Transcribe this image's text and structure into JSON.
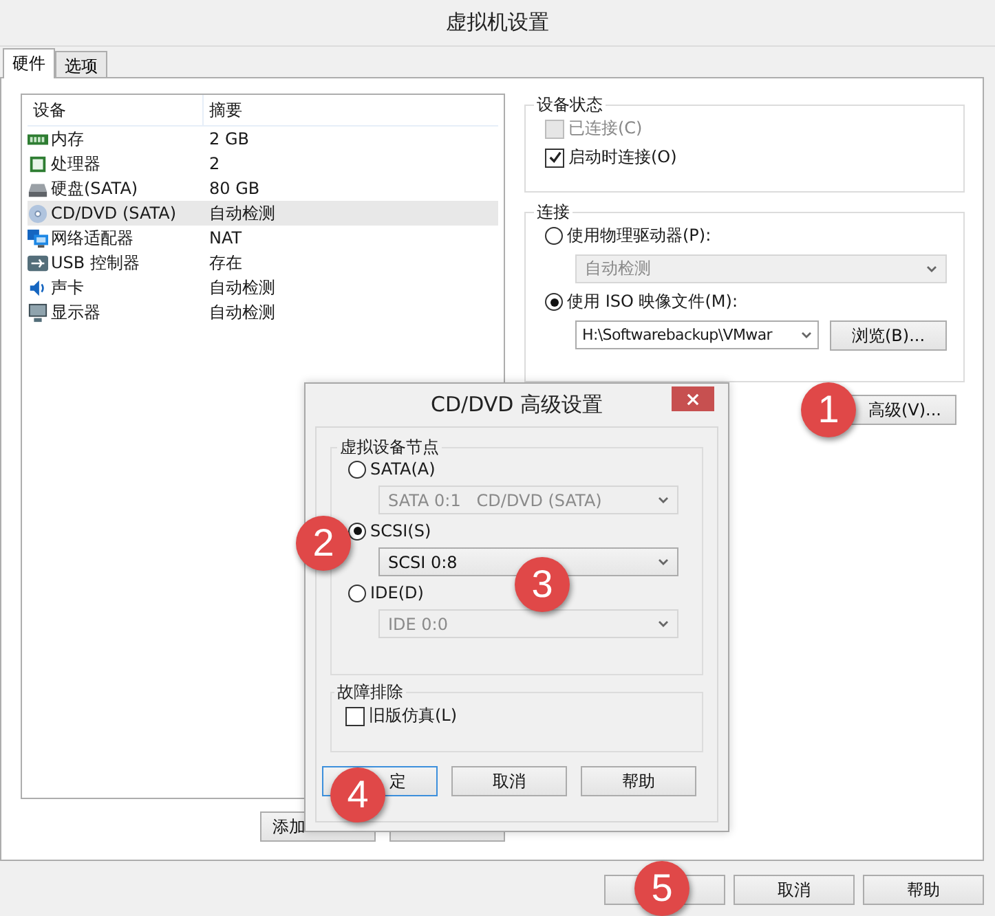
{
  "window": {
    "title": "虚拟机设置"
  },
  "tabs": [
    {
      "label": "硬件",
      "selected": true
    },
    {
      "label": "选项",
      "selected": false
    }
  ],
  "devices": {
    "columns": [
      "设备",
      "摘要"
    ],
    "rows": [
      {
        "kind": "memory",
        "name": "内存",
        "summary": "2 GB",
        "selected": false
      },
      {
        "kind": "cpu",
        "name": "处理器",
        "summary": "2",
        "selected": false
      },
      {
        "kind": "disk",
        "name": "硬盘(SATA)",
        "summary": "80 GB",
        "selected": false
      },
      {
        "kind": "cd",
        "name": "CD/DVD (SATA)",
        "summary": "自动检测",
        "selected": true
      },
      {
        "kind": "network",
        "name": "网络适配器",
        "summary": "NAT",
        "selected": false
      },
      {
        "kind": "usb",
        "name": "USB 控制器",
        "summary": "存在",
        "selected": false
      },
      {
        "kind": "sound",
        "name": "声卡",
        "summary": "自动检测",
        "selected": false
      },
      {
        "kind": "display",
        "name": "显示器",
        "summary": "自动检测",
        "selected": false
      }
    ]
  },
  "list_buttons": [
    {
      "label": "添加"
    }
  ],
  "device_status": {
    "title": "设备状态",
    "options": [
      {
        "label": "已连接(C)",
        "checked": false,
        "disabled": true
      },
      {
        "label": "启动时连接(O)",
        "checked": true,
        "disabled": false
      }
    ]
  },
  "connection": {
    "title": "连接",
    "options": [
      {
        "kind": "dropdown",
        "label": "使用物理驱动器(P):",
        "selected": false,
        "value": "自动检测"
      },
      {
        "kind": "file",
        "label": "使用 ISO 映像文件(M):",
        "selected": true,
        "value": "H:\\Softwarebackup\\VMwar",
        "browse": "浏览(B)..."
      }
    ]
  },
  "advanced_button": "高级(V)...",
  "footer_buttons": [
    {
      "label": "取消"
    },
    {
      "label": "帮助"
    }
  ],
  "dialog": {
    "title": "CD/DVD 高级设置",
    "node_group": {
      "title": "虚拟设备节点",
      "options": [
        {
          "label": "SATA(A)",
          "selected": false,
          "value": "SATA 0:1   CD/DVD (SATA)"
        },
        {
          "label": "SCSI(S)",
          "selected": true,
          "value": "SCSI 0:8"
        },
        {
          "label": "IDE(D)",
          "selected": false,
          "value": "IDE 0:0"
        }
      ]
    },
    "troubleshoot": {
      "title": "故障排除",
      "options": [
        {
          "label": "旧版仿真(L)",
          "checked": false
        }
      ]
    },
    "buttons": [
      {
        "label": "定",
        "default": true
      },
      {
        "label": "取消",
        "default": false
      },
      {
        "label": "帮助",
        "default": false
      }
    ]
  },
  "badges": [
    {
      "label": "1"
    },
    {
      "label": "2"
    },
    {
      "label": "3"
    },
    {
      "label": "4"
    },
    {
      "label": "5"
    }
  ]
}
